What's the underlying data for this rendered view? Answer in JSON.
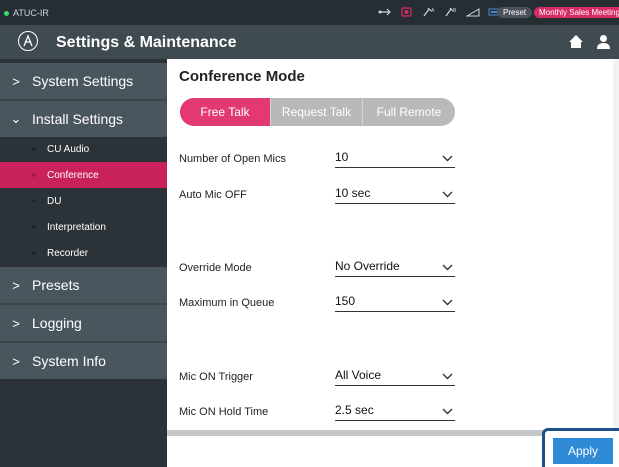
{
  "status_bar": {
    "device_name": "ATUC-IR",
    "preset_label": "Preset",
    "meeting_name": "Monthly Sales Meeting",
    "connection_color": "#2ee06a",
    "accent_color": "#d62c63",
    "icons": [
      "usb-icon",
      "record-icon",
      "mic-icon",
      "mic-mute-icon",
      "signal-icon",
      "battery-icon"
    ]
  },
  "header": {
    "title": "Settings & Maintenance",
    "icons": [
      "logo-icon",
      "home-icon",
      "user-icon"
    ]
  },
  "sidebar": {
    "items": [
      {
        "label": "System Settings",
        "expanded": false
      },
      {
        "label": "Install Settings",
        "expanded": true
      },
      {
        "label": "Presets",
        "expanded": false
      },
      {
        "label": "Logging",
        "expanded": false
      },
      {
        "label": "System Info",
        "expanded": false
      }
    ],
    "sub_items": [
      {
        "label": "CU Audio",
        "active": false
      },
      {
        "label": "Conference",
        "active": true
      },
      {
        "label": "DU",
        "active": false
      },
      {
        "label": "Interpretation",
        "active": false
      },
      {
        "label": "Recorder",
        "active": false
      }
    ],
    "active_color": "#c8215b"
  },
  "main": {
    "title": "Conference Mode",
    "modes": [
      {
        "label": "Free Talk",
        "active": true
      },
      {
        "label": "Request Talk",
        "active": false
      },
      {
        "label": "Full Remote",
        "active": false
      }
    ],
    "fields": [
      {
        "label": "Number of Open Mics",
        "value": "10"
      },
      {
        "label": "Auto Mic OFF",
        "value": "10 sec"
      },
      {
        "label": "Override Mode",
        "value": "No Override"
      },
      {
        "label": "Maximum in Queue",
        "value": "150"
      },
      {
        "label": "Mic ON Trigger",
        "value": "All Voice"
      },
      {
        "label": "Mic ON Hold Time",
        "value": "2.5 sec"
      }
    ],
    "apply_label": "Apply",
    "apply_color": "#2f8ad8"
  }
}
